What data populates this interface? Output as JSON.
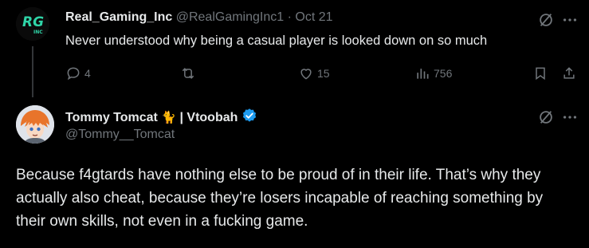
{
  "parent_tweet": {
    "display_name": "Real_Gaming_Inc",
    "handle": "@RealGamingInc1",
    "separator": "·",
    "date": "Oct 21",
    "text": "Never understood why being a casual player is looked down on so much",
    "avatar_text": "RG",
    "avatar_sub": "INC",
    "actions": {
      "replies": "4",
      "retweets": "",
      "likes": "15",
      "views": "756"
    }
  },
  "reply_tweet": {
    "display_name": "Tommy Tomcat",
    "name_emoji": "🐈",
    "name_suffix": "| Vtoobah",
    "handle": "@Tommy__Tomcat",
    "text": "Because f4gtards have nothing else to be proud of in their life. That’s why they actually also cheat, because they’re losers incapable of reaching something by their own skills, not even in a fucking game."
  },
  "colors": {
    "background": "#000000",
    "text": "#e7e9ea",
    "muted": "#71767b",
    "verified": "#1d9bf0",
    "avatar_green": "#2fd5a8"
  },
  "icons": [
    "grok-icon",
    "more-icon",
    "reply-icon",
    "retweet-icon",
    "like-icon",
    "views-icon",
    "bookmark-icon",
    "share-icon",
    "verified-icon"
  ]
}
